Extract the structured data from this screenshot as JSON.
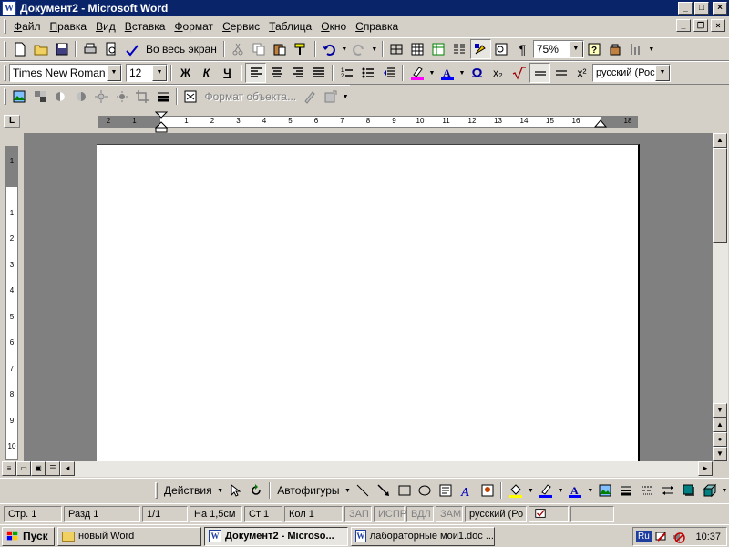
{
  "window": {
    "title": "Документ2 - Microsoft Word",
    "app_icon": "W"
  },
  "menu": {
    "items": [
      "Файл",
      "Правка",
      "Вид",
      "Вставка",
      "Формат",
      "Сервис",
      "Таблица",
      "Окно",
      "Справка"
    ]
  },
  "standard_toolbar": {
    "fullscreen_label": "Во весь экран",
    "zoom": "75%"
  },
  "formatting_toolbar": {
    "font": "Times New Roman",
    "size": "12",
    "bold": "Ж",
    "italic": "К",
    "underline": "Ч",
    "omega": "Ω",
    "subscript": "x₂",
    "superscript": "x²",
    "language": "русский (Росс"
  },
  "picture_toolbar": {
    "format_object": "Формат объекта..."
  },
  "ruler": {
    "corner": "L",
    "h_labels": [
      "2",
      "1",
      "1",
      "2",
      "3",
      "4",
      "5",
      "6",
      "7",
      "8",
      "9",
      "10",
      "11",
      "12",
      "13",
      "14",
      "15",
      "16",
      "18"
    ],
    "v_labels": [
      "1",
      "1",
      "2",
      "3",
      "4",
      "5",
      "6",
      "7",
      "8",
      "9",
      "10"
    ]
  },
  "drawing_toolbar": {
    "actions": "Действия",
    "autoshapes": "Автофигуры"
  },
  "status": {
    "page": "Стр. 1",
    "section": "Разд 1",
    "pages": "1/1",
    "at": "На 1,5см",
    "line": "Ст 1",
    "col": "Кол 1",
    "rec": "ЗАП",
    "trk": "ИСПР",
    "ext": "ВДЛ",
    "ovr": "ЗАМ",
    "lang": "русский (Ро"
  },
  "taskbar": {
    "start": "Пуск",
    "tasks": [
      {
        "label": "новый Word",
        "icon": "folder-icon",
        "active": false
      },
      {
        "label": "Документ2 - Microso...",
        "icon": "word-icon",
        "active": true
      },
      {
        "label": "лабораторные мои1.doc ...",
        "icon": "word-icon",
        "active": false
      }
    ],
    "lang": "Ru",
    "clock": "10:37"
  }
}
